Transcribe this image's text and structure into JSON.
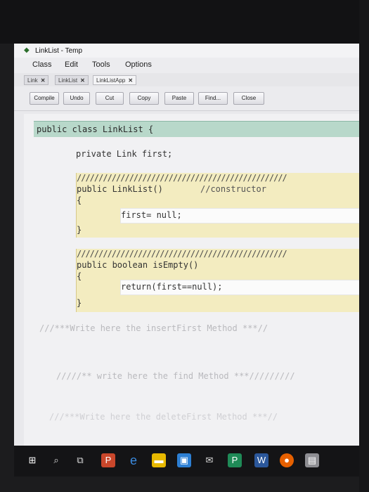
{
  "window": {
    "title": "LinkList - Temp"
  },
  "menu": [
    "Class",
    "Edit",
    "Tools",
    "Options"
  ],
  "tabs": [
    {
      "label": "Link",
      "active": false
    },
    {
      "label": "LinkList",
      "active": false
    },
    {
      "label": "LinkListApp",
      "active": true
    }
  ],
  "toolbar": [
    "Compile",
    "Undo",
    "Cut",
    "Copy",
    "Paste",
    "Find...",
    "Close"
  ],
  "code": {
    "class_decl": "public class LinkList {",
    "field": "private Link first;",
    "sep1": "////////////////////////////////////////////////",
    "ctor_sig": "public LinkList()",
    "ctor_comment": "//constructor",
    "brace_open": "{",
    "ctor_body": "first= null;",
    "brace_close": "}",
    "sep2": "////////////////////////////////////////////////",
    "isempty_sig": "public boolean isEmpty()",
    "isempty_body": "return(first==null);",
    "comment_insert": "///***Write here the insertFirst Method ***//",
    "comment_find": "/////** write here the find Method ***/////////",
    "comment_delete": "///***Write here the deleteFirst Method ***//"
  },
  "taskbar": {
    "icons": [
      "windows-start",
      "search",
      "task-view",
      "powerpoint",
      "edge",
      "file-explorer",
      "store",
      "mail",
      "publisher",
      "word",
      "firefox",
      "bluej"
    ]
  },
  "colors": {
    "class_header": "#b8d8ca",
    "method_block": "#f3ecc0",
    "editor_bg": "#f1f1f3"
  }
}
